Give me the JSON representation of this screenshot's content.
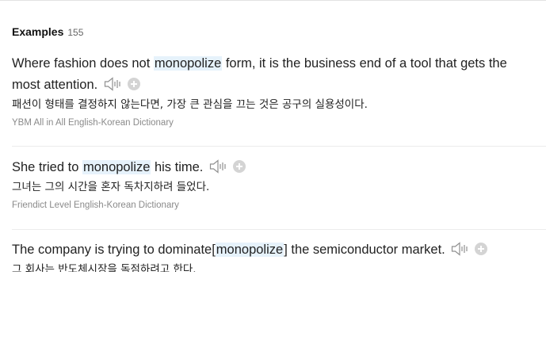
{
  "header": {
    "title": "Examples",
    "count": "155"
  },
  "examples": [
    {
      "before": "Where fashion does not ",
      "highlight": "monopolize",
      "after": " form, it is the business end of a tool that gets the most attention.",
      "translation": "패션이 형태를 결정하지 않는다면, 가장 큰 관심을 끄는 것은 공구의 실용성이다.",
      "source": "YBM All in All English-Korean Dictionary"
    },
    {
      "before": "She tried to ",
      "highlight": "monopolize",
      "after": " his time.",
      "translation": "그녀는 그의 시간을 혼자 독차지하려 들었다.",
      "source": "Friendict Level English-Korean Dictionary"
    },
    {
      "before": "The company is trying to dominate[",
      "highlight": "monopolize",
      "after": "] the semiconductor market.",
      "translation": "그 회사는 반도체시장을 독점하려고 한다.",
      "source": ""
    }
  ],
  "icons": {
    "speaker": "speaker-icon",
    "add": "plus-circle-icon"
  },
  "colors": {
    "highlight_bg": "#e6f2fb",
    "source_text": "#8a8a8a",
    "divider": "#ececec"
  }
}
